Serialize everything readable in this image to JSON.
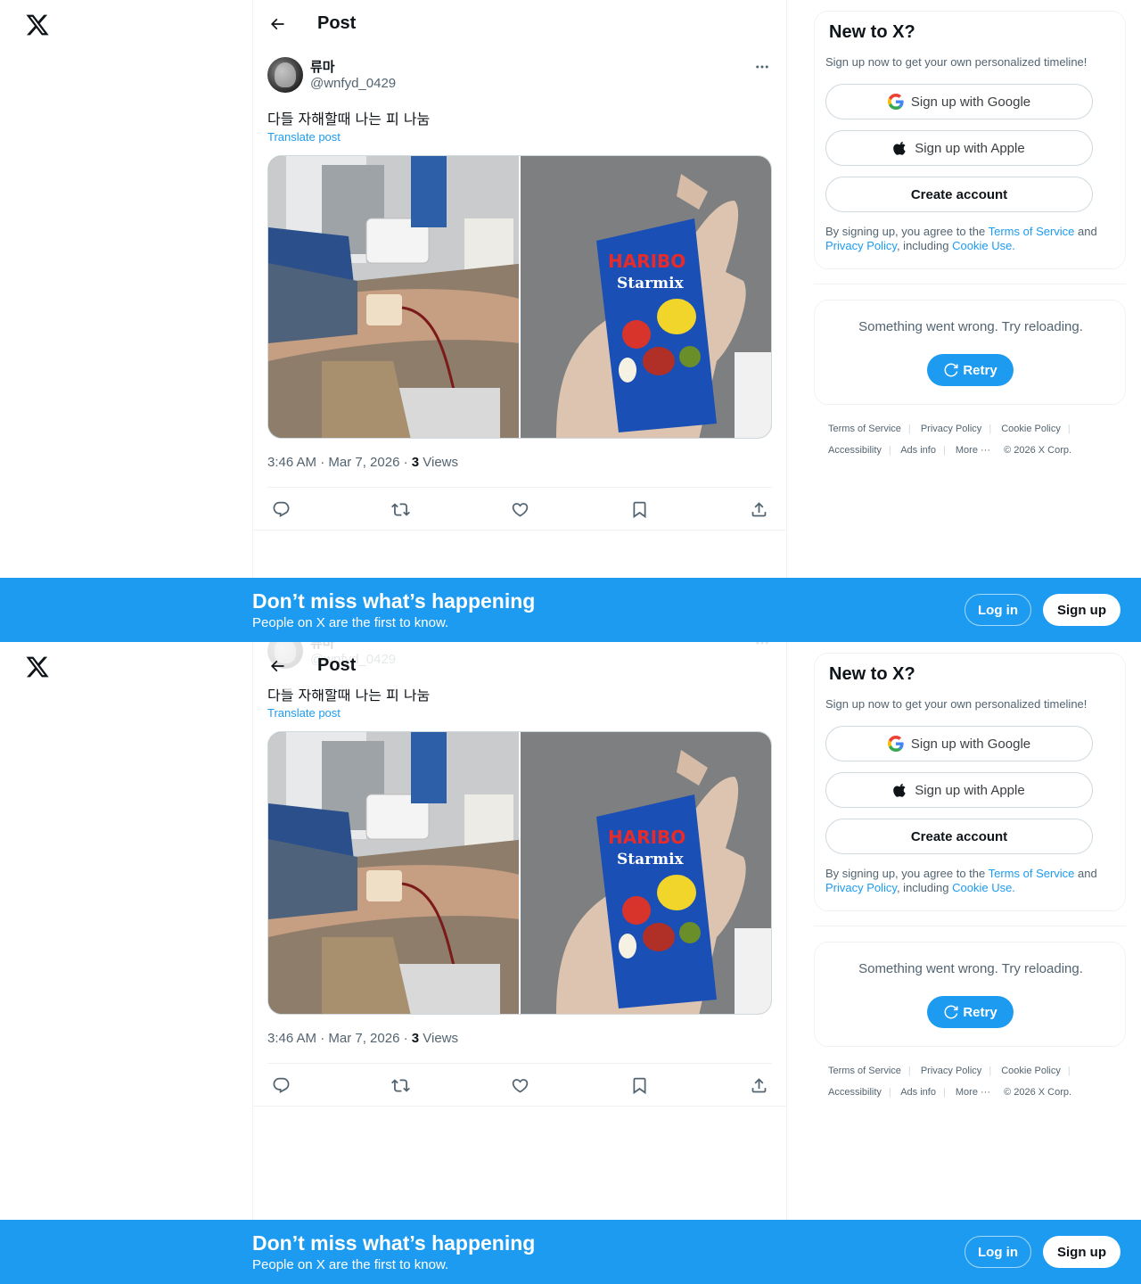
{
  "nav": {
    "logo": "x-logo"
  },
  "header": {
    "title": "Post",
    "back_icon": "back-arrow-icon"
  },
  "post": {
    "author_name": "류마",
    "author_handle": "@wnfyd_0429",
    "text": "다들 자해할때 나는 피 나눔",
    "translate_label": "Translate post",
    "timestamp": "3:46 AM · Mar 7, 2026 · ",
    "views_count": "3",
    "views_label": " Views",
    "media": [
      {
        "description": "blood donation arm"
      },
      {
        "description": "hand holding haribo candy"
      }
    ],
    "candy_brand": "HARIBO",
    "candy_product": "Starmix",
    "actions": [
      "reply-icon",
      "repost-icon",
      "like-icon",
      "bookmark-icon",
      "share-icon"
    ]
  },
  "signup_card": {
    "title": "New to X?",
    "subtitle": "Sign up now to get your own personalized timeline!",
    "google_label": "Sign up with Google",
    "apple_label": "Sign up with Apple",
    "create_label": "Create account",
    "legal_pre": "By signing up, you agree to the ",
    "tos": "Terms of Service",
    "and": " and ",
    "privacy": "Privacy Policy",
    "including": ", including ",
    "cookie": "Cookie Use."
  },
  "error_card": {
    "message": "Something went wrong. Try reloading.",
    "retry_label": "Retry"
  },
  "footer": {
    "links": [
      "Terms of Service",
      "Privacy Policy",
      "Cookie Policy",
      "Accessibility",
      "Ads info",
      "More ···"
    ],
    "copyright": "© 2026 X Corp."
  },
  "banner": {
    "title": "Don’t miss what’s happening",
    "subtitle": "People on X are the first to know.",
    "login_label": "Log in",
    "signup_label": "Sign up"
  },
  "colors": {
    "accent": "#1d9bf0",
    "text": "#0f1419",
    "muted": "#536471",
    "border": "#eff3f4"
  }
}
